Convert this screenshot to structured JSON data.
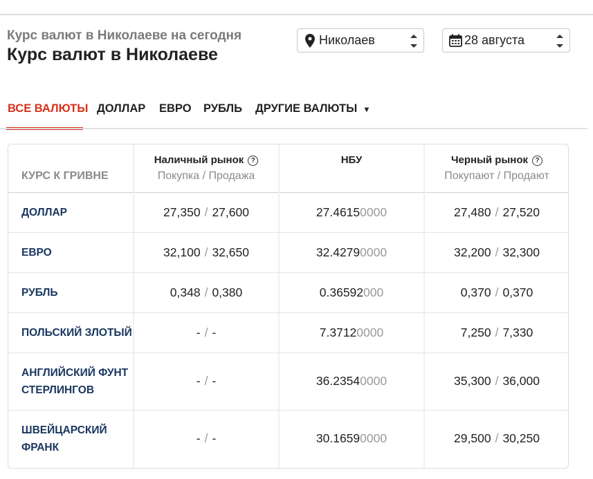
{
  "header": {
    "subtitle": "Курс валют в Николаеве на сегодня",
    "title": "Курс валют в Николаеве"
  },
  "filters": {
    "city": {
      "value": "Николаев",
      "icon": "location-pin-icon"
    },
    "date": {
      "value": "28 августа",
      "icon": "calendar-icon"
    }
  },
  "tabs": [
    {
      "label": "ВСЕ ВАЛЮТЫ",
      "active": true
    },
    {
      "label": "ДОЛЛАР"
    },
    {
      "label": "ЕВРО"
    },
    {
      "label": "РУБЛЬ"
    },
    {
      "label": "ДРУГИЕ ВАЛЮТЫ",
      "dropdown": "▾"
    }
  ],
  "table": {
    "row_header": "КУРС К ГРИВНЕ",
    "columns": [
      {
        "title": "Наличный рынок",
        "help": "?",
        "subtitle": "Покупка / Продажа"
      },
      {
        "title": "НБУ",
        "subtitle": ""
      },
      {
        "title": "Черный рынок",
        "help": "?",
        "subtitle": "Покупают / Продают"
      }
    ],
    "slash": "/",
    "rows": [
      {
        "name": "ДОЛЛАР",
        "cash_buy": "27,350",
        "cash_sell": "27,600",
        "nbu_main": "27.4615",
        "nbu_tail": "0000",
        "black_buy": "27,480",
        "black_sell": "27,520"
      },
      {
        "name": "ЕВРО",
        "cash_buy": "32,100",
        "cash_sell": "32,650",
        "nbu_main": "32.4279",
        "nbu_tail": "0000",
        "black_buy": "32,200",
        "black_sell": "32,300"
      },
      {
        "name": "РУБЛЬ",
        "cash_buy": "0,348",
        "cash_sell": "0,380",
        "nbu_main": "0.36592",
        "nbu_tail": "000",
        "black_buy": "0,370",
        "black_sell": "0,370"
      },
      {
        "name": "ПОЛЬСКИЙ ЗЛОТЫЙ",
        "cash_buy": "-",
        "cash_sell": "-",
        "nbu_main": "7.3712",
        "nbu_tail": "0000",
        "black_buy": "7,250",
        "black_sell": "7,330"
      },
      {
        "name": "АНГЛИЙСКИЙ ФУНТ СТЕРЛИНГОВ",
        "name_line1": "АНГЛИЙСКИЙ ФУНТ",
        "name_line2": "СТЕРЛИНГОВ",
        "cash_buy": "-",
        "cash_sell": "-",
        "nbu_main": "36.2354",
        "nbu_tail": "0000",
        "black_buy": "35,300",
        "black_sell": "36,000"
      },
      {
        "name": "ШВЕЙЦАРСКИЙ ФРАНК",
        "name_line1": "ШВЕЙЦАРСКИЙ",
        "name_line2": "ФРАНК",
        "cash_buy": "-",
        "cash_sell": "-",
        "nbu_main": "30.1659",
        "nbu_tail": "0000",
        "black_buy": "29,500",
        "black_sell": "30,250"
      }
    ]
  },
  "colors": {
    "accent": "#d6311c",
    "currency_name": "#1a3760",
    "muted": "#8a8a8a"
  }
}
